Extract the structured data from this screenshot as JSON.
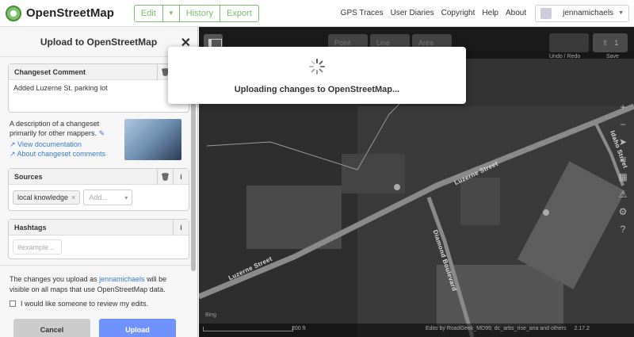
{
  "nav": {
    "brand": "OpenStreetMap",
    "edit": "Edit",
    "history": "History",
    "export": "Export",
    "links": [
      "GPS Traces",
      "User Diaries",
      "Copyright",
      "Help",
      "About"
    ],
    "username": "jennamichaels"
  },
  "sidebar": {
    "title": "Upload to OpenStreetMap",
    "comment": {
      "label": "Changeset Comment",
      "value": "Added Luzerne St. parking lot"
    },
    "description": "A description of a changeset primarily for other mappers.",
    "view_docs": "View documentation",
    "about_comments": "About changeset comments",
    "sources": {
      "label": "Sources",
      "chip": "local knowledge",
      "placeholder": "Add..."
    },
    "hashtags": {
      "label": "Hashtags",
      "placeholder": "#example..."
    },
    "footer_pre": "The changes you upload as ",
    "footer_user": "jennamichaels",
    "footer_post": " will be visible on all maps that use OpenStreetMap data.",
    "review": "I would like someone to review my edits.",
    "cancel": "Cancel",
    "upload": "Upload"
  },
  "map": {
    "undo_label": "Undo / Redo",
    "save_label": "Save",
    "save_count": "1",
    "tools": [
      "Point",
      "Line",
      "Area"
    ],
    "streets": [
      "Luzerne Street",
      "Luzerne Street",
      "Diamond Boulevard",
      "Idaho Street"
    ],
    "scale": "200 ft",
    "imagery": "Bing",
    "attribution_pre": "Edits by ",
    "attribution_users": "RoadGeek_MD99, dc_arbs_rise_ana",
    "attribution_and": " and ",
    "attribution_others": " others",
    "version": "2.17.2"
  },
  "modal": {
    "message": "Uploading changes to OpenStreetMap..."
  }
}
